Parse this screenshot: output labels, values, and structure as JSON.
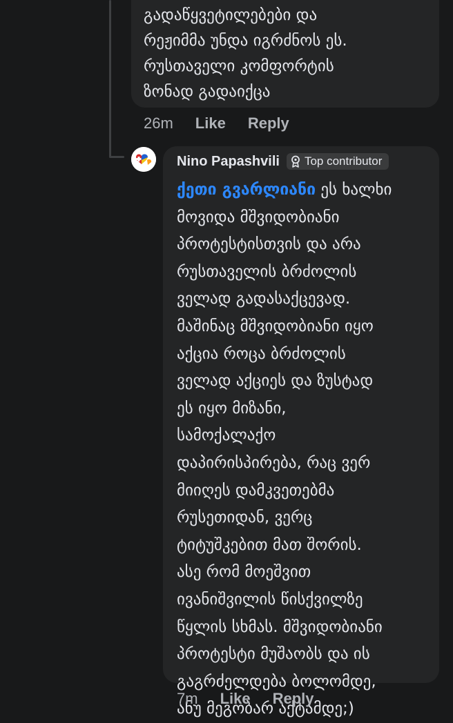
{
  "previous_comment": {
    "text_lines": [
      "გადაწყვეტილებები და",
      "რეჟიმმა უნდა იგრძნოს ეს.",
      "რუსთაველი კომფორტის",
      "ზონად გადაიქცა"
    ],
    "time": "26m",
    "like_label": "Like",
    "reply_label": "Reply"
  },
  "reply_comment": {
    "author": "Nino Papashvili",
    "badge": "Top contributor",
    "mention": "ქეთი გვარლიანი",
    "first_line_rest": " ეს ხალხი",
    "text_lines": [
      "მოვიდა მშვიდობიანი",
      "პროტესტისთვის და არა",
      "რუსთაველის ბრძოლის",
      "ველად გადასაქცევად.",
      "მაშინაც მშვიდობიანი იყო",
      "აქცია როცა ბრძოლის",
      "ველად აქციეს და ზუსტად",
      "ეს იყო მიზანი,",
      "სამოქალაქო",
      "დაპირისპირება, რაც ვერ",
      "მიიღეს დამკვეთებმა",
      "რუსეთიდან, ვერც",
      "ტიტუშკებით მათ შორის.",
      "ასე რომ მოეშვით",
      "ივანიშვილის წისქვილზე",
      "წყლის სხმას. მშვიდობიანი",
      "პროტესტი მუშაობს და ის",
      "გაგრძელდება ბოლომდე,",
      "ანუ მეგობარ აქტამდე;)"
    ],
    "time": "7m",
    "like_label": "Like",
    "reply_label": "Reply"
  },
  "colors": {
    "background": "#18191a",
    "bubble": "#242526",
    "text": "#e4e6eb",
    "muted": "#b0b3b8",
    "mention": "#2d88ff",
    "badge_bg": "#3a3b3c"
  }
}
